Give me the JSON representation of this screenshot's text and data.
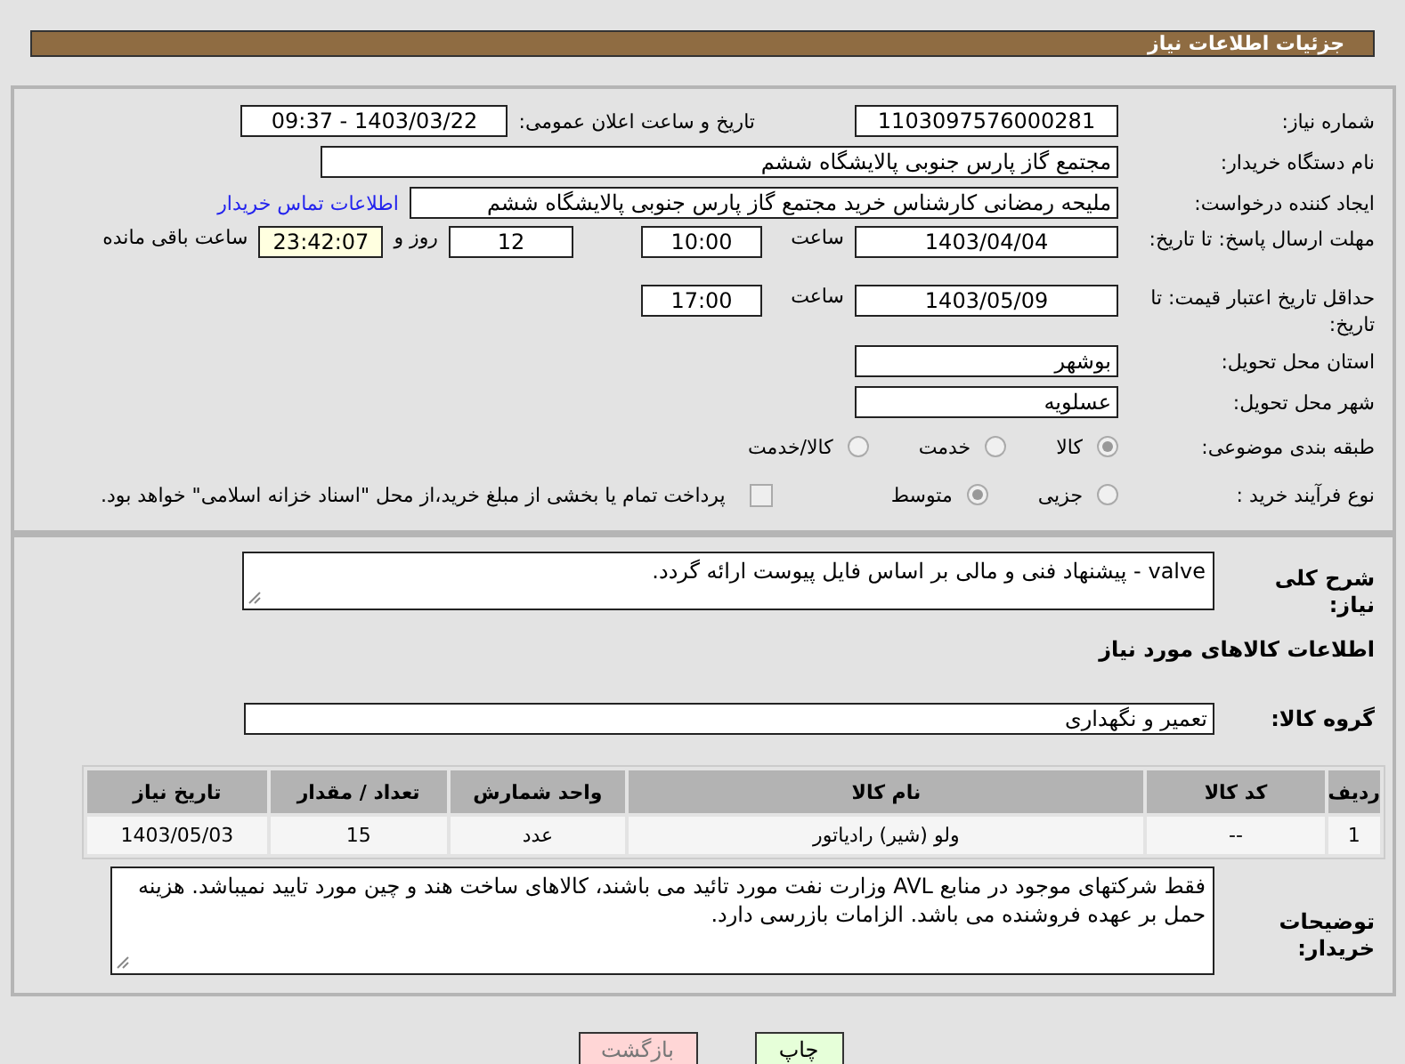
{
  "header": {
    "title": "جزئیات اطلاعات نیاز"
  },
  "details": {
    "need_number": {
      "label": "شماره نیاز:",
      "value": "1103097576000281"
    },
    "announce": {
      "label": "تاریخ و ساعت اعلان عمومی:",
      "value": "1403/03/22 - 09:37"
    },
    "buyer_org": {
      "label": "نام دستگاه خریدار:",
      "value": "مجتمع گاز پارس جنوبی  پالایشگاه ششم"
    },
    "requester": {
      "label": "ایجاد کننده درخواست:",
      "value": "ملیحه رمضانی کارشناس خرید مجتمع گاز پارس جنوبی  پالایشگاه ششم",
      "contact_link": "اطلاعات تماس خریدار"
    },
    "reply_deadline": {
      "label": "مهلت ارسال پاسخ: تا تاریخ:",
      "date": "1403/04/04",
      "time_label": "ساعت",
      "time": "10:00",
      "days": "12",
      "days_label": "روز و",
      "remaining": "23:42:07",
      "remaining_label": "ساعت باقی مانده"
    },
    "price_validity": {
      "label": "حداقل تاریخ اعتبار قیمت: تا تاریخ:",
      "date": "1403/05/09",
      "time_label": "ساعت",
      "time": "17:00"
    },
    "province": {
      "label": "استان محل تحویل:",
      "value": "بوشهر"
    },
    "city": {
      "label": "شهر محل تحویل:",
      "value": "عسلویه"
    },
    "category": {
      "label": "طبقه بندی موضوعی:",
      "options": [
        {
          "label": "کالا",
          "selected": true
        },
        {
          "label": "خدمت",
          "selected": false
        },
        {
          "label": "کالا/خدمت",
          "selected": false
        }
      ]
    },
    "purchase_process": {
      "label": "نوع فرآیند خرید :",
      "options": [
        {
          "label": "جزیی",
          "selected": false
        },
        {
          "label": "متوسط",
          "selected": true
        }
      ],
      "treasury": {
        "checked": false,
        "text": "پرداخت تمام یا بخشی از مبلغ خرید،از محل \"اسناد خزانه اسلامی\" خواهد بود."
      }
    }
  },
  "description": {
    "label": "شرح کلی نیاز:",
    "value": "valve  -  پیشنهاد فنی و مالی بر اساس فایل پیوست ارائه گردد."
  },
  "goods_heading": "اطلاعات کالاهای مورد نیاز",
  "goods_group": {
    "label": "گروه کالا:",
    "value": "تعمیر و نگهداری"
  },
  "table": {
    "columns": [
      "ردیف",
      "کد کالا",
      "نام کالا",
      "واحد شمارش",
      "تعداد / مقدار",
      "تاریخ نیاز"
    ],
    "rows": [
      [
        "1",
        "--",
        "ولو (شیر) رادیاتور",
        "عدد",
        "15",
        "1403/05/03"
      ]
    ]
  },
  "buyer_notes": {
    "label": "توضیحات خریدار:",
    "value": "فقط شرکتهای موجود در منابع AVL وزارت نفت مورد تائید می باشند، کالاهای ساخت هند و چین مورد تایید نمیباشد. هزینه حمل بر عهده فروشنده می باشد. الزامات بازرسی دارد."
  },
  "buttons": [
    {
      "label": "چاپ",
      "kind": "print"
    },
    {
      "label": "بازگشت",
      "kind": "back"
    }
  ]
}
